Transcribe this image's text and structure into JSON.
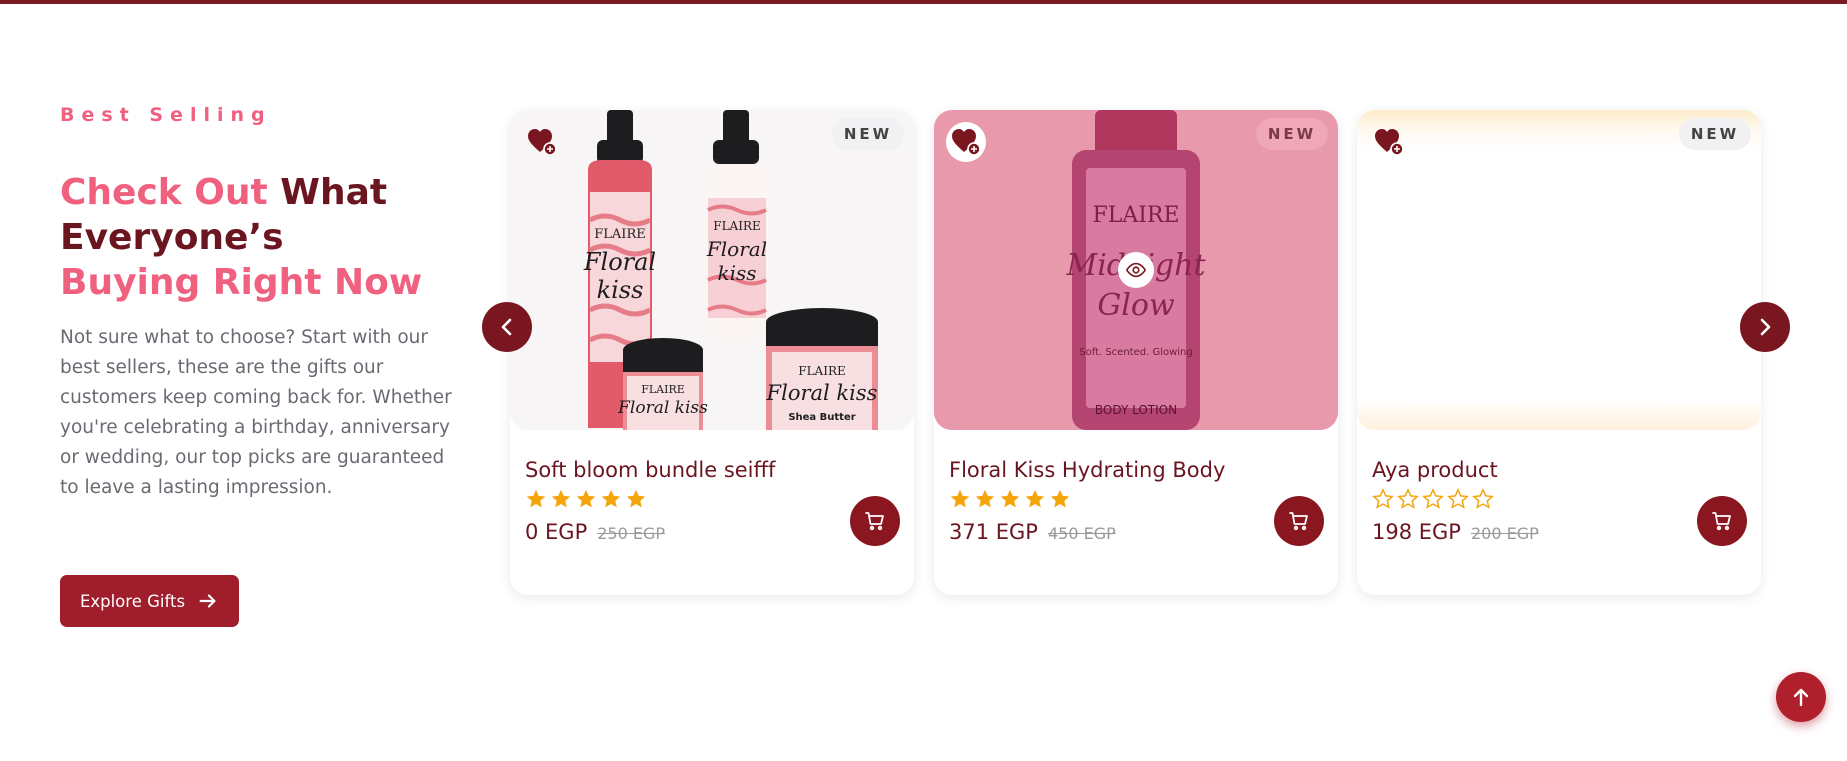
{
  "section": {
    "kicker": "Best Selling",
    "headline_pink_1": "Check Out",
    "headline_dark": " What Everyone’s",
    "headline_pink_2": "Buying Right Now",
    "description": "Not sure what to choose? Start with our best sellers, these are the gifts our customers keep coming back for. Whether you're celebrating a birthday, anniversary or wedding, our top picks are guaranteed to leave a lasting impression.",
    "explore_label": "Explore Gifts"
  },
  "products": [
    {
      "badge": "NEW",
      "title": "Soft bloom bundle seifff",
      "rating": 5,
      "price": "0 EGP",
      "old_price": "250 EGP",
      "image_text": {
        "brand": "FLAIRE",
        "name_1": "Floral",
        "name_2": "kiss",
        "sub": "Shea Butter"
      }
    },
    {
      "badge": "NEW",
      "title": "Floral Kiss Hydrating Body",
      "rating": 5,
      "price": "371 EGP",
      "old_price": "450 EGP",
      "image_text": {
        "brand": "FLAIRE",
        "name_1": "Midnight",
        "name_2": "Glow",
        "tagline": "Soft. Scented. Glowing",
        "label": "BODY LOTION"
      }
    },
    {
      "badge": "NEW",
      "title": "Aya product",
      "rating": 0,
      "price": "198 EGP",
      "old_price": "200 EGP"
    }
  ],
  "colors": {
    "brand": "#7a1620",
    "accent_pink": "#f0607f",
    "star": "#f5a40b"
  },
  "icons": {
    "prev": "chevron-left-icon",
    "next": "chevron-right-icon",
    "cart": "cart-icon",
    "wishlist": "heart-plus-icon",
    "quickview": "eye-icon",
    "top": "arrow-up-icon"
  }
}
